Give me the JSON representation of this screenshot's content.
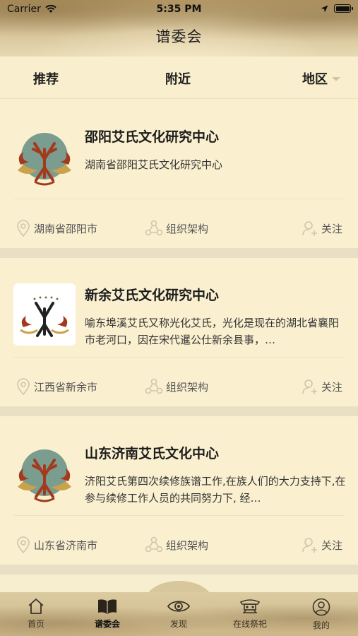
{
  "status_bar": {
    "carrier": "Carrier",
    "time": "5:35 PM"
  },
  "nav": {
    "title": "谱委会"
  },
  "filters": {
    "recommend": "推荐",
    "nearby": "附近",
    "region": "地区"
  },
  "cards": [
    {
      "title": "邵阳艾氏文化研究中心",
      "description": "湖南省邵阳艾氏文化研究中心",
      "location": "湖南省邵阳市",
      "org_label": "组织架构",
      "follow_label": "关注",
      "logo_icon": "clan-emblem-icon"
    },
    {
      "title": "新余艾氏文化研究中心",
      "description": "喻东埠溪艾氏又称光化艾氏，光化是现在的湖北省襄阳市老河口，因在宋代暹公仕新余县事，…",
      "location": "江西省新余市",
      "org_label": "组织架构",
      "follow_label": "关注",
      "logo_icon": "clan-emblem-icon"
    },
    {
      "title": "山东济南艾氏文化中心",
      "description": "济阳艾氏第四次续修族谱工作,在族人们的大力支持下,在参与续修工作人员的共同努力下, 经…",
      "location": "山东省济南市",
      "org_label": "组织架构",
      "follow_label": "关注",
      "logo_icon": "clan-emblem-icon"
    }
  ],
  "tabbar": [
    {
      "label": "首页",
      "icon": "home-icon",
      "active": false
    },
    {
      "label": "谱委会",
      "icon": "book-icon",
      "active": true
    },
    {
      "label": "发现",
      "icon": "eye-icon",
      "active": false
    },
    {
      "label": "在线祭祀",
      "icon": "shrine-icon",
      "active": false
    },
    {
      "label": "我的",
      "icon": "user-icon",
      "active": false
    }
  ],
  "colors": {
    "background": "#f7eecf",
    "separator": "#e8dfc4",
    "emblem_red": "#a33a1e",
    "emblem_teal": "#7a9d8f"
  }
}
